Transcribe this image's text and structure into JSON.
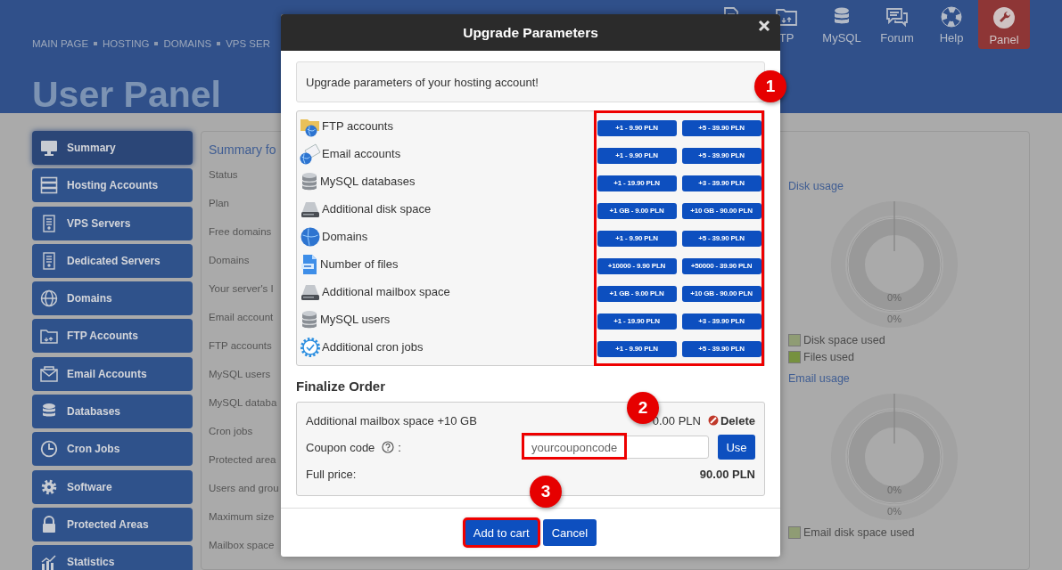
{
  "header": {
    "breadcrumb": [
      "MAIN PAGE",
      "HOSTING",
      "DOMAINS",
      "VPS SER"
    ],
    "title": "User Panel",
    "nav": [
      {
        "selected": false
      },
      {
        "label": "TP",
        "selected": false
      },
      {
        "label": "MySQL",
        "selected": false
      },
      {
        "label": "Forum",
        "selected": false
      },
      {
        "label": "Help",
        "selected": false
      },
      {
        "label": "Panel",
        "selected": true
      }
    ]
  },
  "sidebar": {
    "items": [
      {
        "label": "Summary",
        "selected": true
      },
      {
        "label": "Hosting Accounts",
        "selected": false
      },
      {
        "label": "VPS Servers",
        "selected": false
      },
      {
        "label": "Dedicated Servers",
        "selected": false
      },
      {
        "label": "Domains",
        "selected": false
      },
      {
        "label": "FTP Accounts",
        "selected": false
      },
      {
        "label": "Email Accounts",
        "selected": false
      },
      {
        "label": "Databases",
        "selected": false
      },
      {
        "label": "Cron Jobs",
        "selected": false
      },
      {
        "label": "Software",
        "selected": false
      },
      {
        "label": "Protected Areas",
        "selected": false
      },
      {
        "label": "Statistics",
        "selected": false
      }
    ]
  },
  "summary": {
    "title": "Summary fo",
    "labels": [
      "Status",
      "Plan",
      "Free domains",
      "Domains",
      "Your server's I",
      "Email account",
      "FTP accounts",
      "MySQL users",
      "MySQL databa",
      "Cron jobs",
      "Protected area",
      "Users and grou",
      "Maximum size",
      "Mailbox space"
    ]
  },
  "usage": [
    {
      "title": "Disk usage",
      "inner_label": "0%",
      "outer_label": "0%",
      "legend": [
        {
          "label": "Disk space used",
          "color": "#8f9c74"
        },
        {
          "label": "Files used",
          "color": "#76913f"
        }
      ]
    },
    {
      "title": "Email usage",
      "inner_label": "0%",
      "outer_label": "0%",
      "legend": [
        {
          "label": "Email disk space used",
          "color": "#8f9c74"
        }
      ]
    }
  ],
  "modal": {
    "title": "Upgrade Parameters",
    "intro": "Upgrade parameters of your hosting account!",
    "options": [
      {
        "label": "FTP accounts",
        "buttons": [
          "+1 - 9.90 PLN",
          "+5 - 39.90 PLN"
        ]
      },
      {
        "label": "Email accounts",
        "buttons": [
          "+1 - 9.90 PLN",
          "+5 - 39.90 PLN"
        ]
      },
      {
        "label": "MySQL databases",
        "buttons": [
          "+1 - 19.90 PLN",
          "+3 - 39.90 PLN"
        ]
      },
      {
        "label": "Additional disk space",
        "buttons": [
          "+1 GB - 9.00 PLN",
          "+10 GB - 90.00 PLN"
        ]
      },
      {
        "label": "Domains",
        "buttons": [
          "+1 - 9.90 PLN",
          "+5 - 39.90 PLN"
        ]
      },
      {
        "label": "Number of files",
        "buttons": [
          "+10000 - 9.90 PLN",
          "+50000 - 39.90 PLN"
        ]
      },
      {
        "label": "Additional mailbox space",
        "buttons": [
          "+1 GB - 9.00 PLN",
          "+10 GB - 90.00 PLN"
        ]
      },
      {
        "label": "MySQL users",
        "buttons": [
          "+1 - 19.90 PLN",
          "+3 - 39.90 PLN"
        ]
      },
      {
        "label": "Additional cron jobs",
        "buttons": [
          "+1 - 9.90 PLN",
          "+5 - 39.90 PLN"
        ]
      }
    ],
    "finalize": {
      "heading": "Finalize Order",
      "item": "Additional mailbox space +10 GB",
      "item_price": "0.00 PLN",
      "delete": "Delete",
      "coupon_label": "Coupon code",
      "coupon_suffix": ":",
      "coupon_placeholder": "yourcouponcode",
      "use": "Use",
      "total_label": "Full price:",
      "total": "90.00 PLN"
    },
    "options_highlighted": true,
    "coupon_highlighted": true,
    "buttons": [
      {
        "label": "Add to cart",
        "highlighted": true
      },
      {
        "label": "Cancel",
        "highlighted": false
      }
    ]
  },
  "annotations": [
    {
      "number": "1"
    },
    {
      "number": "2"
    },
    {
      "number": "3"
    }
  ]
}
